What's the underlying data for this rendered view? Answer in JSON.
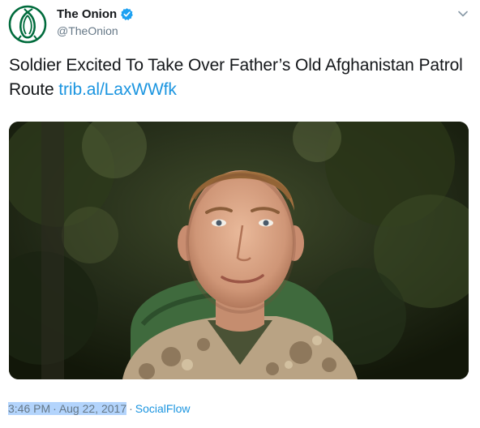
{
  "tweet": {
    "display_name": "The Onion",
    "handle": "@TheOnion",
    "text": "Soldier Excited To Take Over Father’s Old Afghanistan Patrol Route",
    "link": "trib.al/LaxWWfk",
    "time": "3:46 PM",
    "date": "Aug 22, 2017",
    "separator": "·",
    "source": "SocialFlow"
  },
  "colors": {
    "brand_green": "#006b3c",
    "link_blue": "#1b95e0",
    "verified_blue": "#1da1f2",
    "secondary_text": "#657786"
  },
  "icons": {
    "avatar": "onion-logo-icon",
    "verified": "verified-badge-icon",
    "menu": "chevron-down-icon"
  }
}
